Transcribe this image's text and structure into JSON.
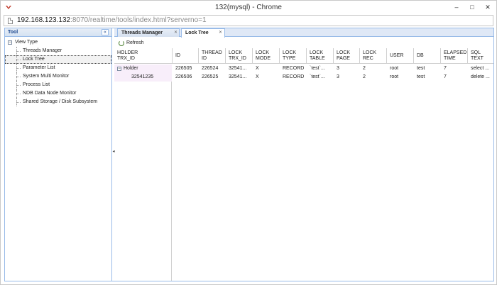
{
  "window": {
    "title": "132(mysql) - Chrome",
    "controls": {
      "minimize": "–",
      "maximize": "□",
      "close": "✕"
    }
  },
  "address": {
    "host": "192.168.123.132",
    "rest": ":8070/realtime/tools/index.html?serverno=1"
  },
  "left_panel": {
    "title": "Tool",
    "collapse_glyph": "«",
    "root": {
      "toggle": "−",
      "label": "View Type"
    },
    "items": [
      {
        "label": "Threads Manager"
      },
      {
        "label": "Lock Tree"
      },
      {
        "label": "Parameter List"
      },
      {
        "label": "System Multi Monitor"
      },
      {
        "label": "Process List"
      },
      {
        "label": "NDB Data Node Monitor"
      },
      {
        "label": "Shared Storage / Disk Subsystem"
      }
    ],
    "selected_index": 1
  },
  "splitter": {
    "glyph": "◂"
  },
  "tabs": [
    {
      "label": "Threads Manager",
      "close": "✕",
      "active": false
    },
    {
      "label": "Lock Tree",
      "close": "✕",
      "active": true
    }
  ],
  "toolbar": {
    "refresh_label": "Refresh"
  },
  "grid": {
    "columns": [
      {
        "line1": "HOLDER",
        "line2": "TRX_ID"
      },
      {
        "line1": "ID",
        "line2": ""
      },
      {
        "line1": "THREAD",
        "line2": "ID"
      },
      {
        "line1": "LOCK",
        "line2": "TRX_ID"
      },
      {
        "line1": "LOCK",
        "line2": "MODE"
      },
      {
        "line1": "LOCK",
        "line2": "TYPE"
      },
      {
        "line1": "LOCK",
        "line2": "TABLE"
      },
      {
        "line1": "LOCK",
        "line2": "PAGE"
      },
      {
        "line1": "LOCK",
        "line2": "REC"
      },
      {
        "line1": "USER",
        "line2": ""
      },
      {
        "line1": "DB",
        "line2": ""
      },
      {
        "line1": "ELAPSED",
        "line2": "TIME"
      },
      {
        "line1": "SQL",
        "line2": "TEXT"
      }
    ],
    "rows": [
      {
        "holder": "Holder",
        "toggle": "−",
        "id": "226505",
        "thread_id": "226524",
        "lock_trx_id": "32541...",
        "lock_mode": "X",
        "lock_type": "RECORD",
        "lock_table": "`test`...",
        "lock_page": "3",
        "lock_rec": "2",
        "user": "root",
        "db": "test",
        "elapsed": "7",
        "sql": "select ..."
      },
      {
        "holder": "32541235",
        "toggle": "",
        "id": "226506",
        "thread_id": "226525",
        "lock_trx_id": "32541...",
        "lock_mode": "X",
        "lock_type": "RECORD",
        "lock_table": "`test`...",
        "lock_page": "3",
        "lock_rec": "2",
        "user": "root",
        "db": "test",
        "elapsed": "7",
        "sql": "delete ..."
      }
    ]
  },
  "colors": {
    "panel_border": "#99bbe8",
    "header_text": "#15428b",
    "holder_bg": "#f8eefa"
  }
}
